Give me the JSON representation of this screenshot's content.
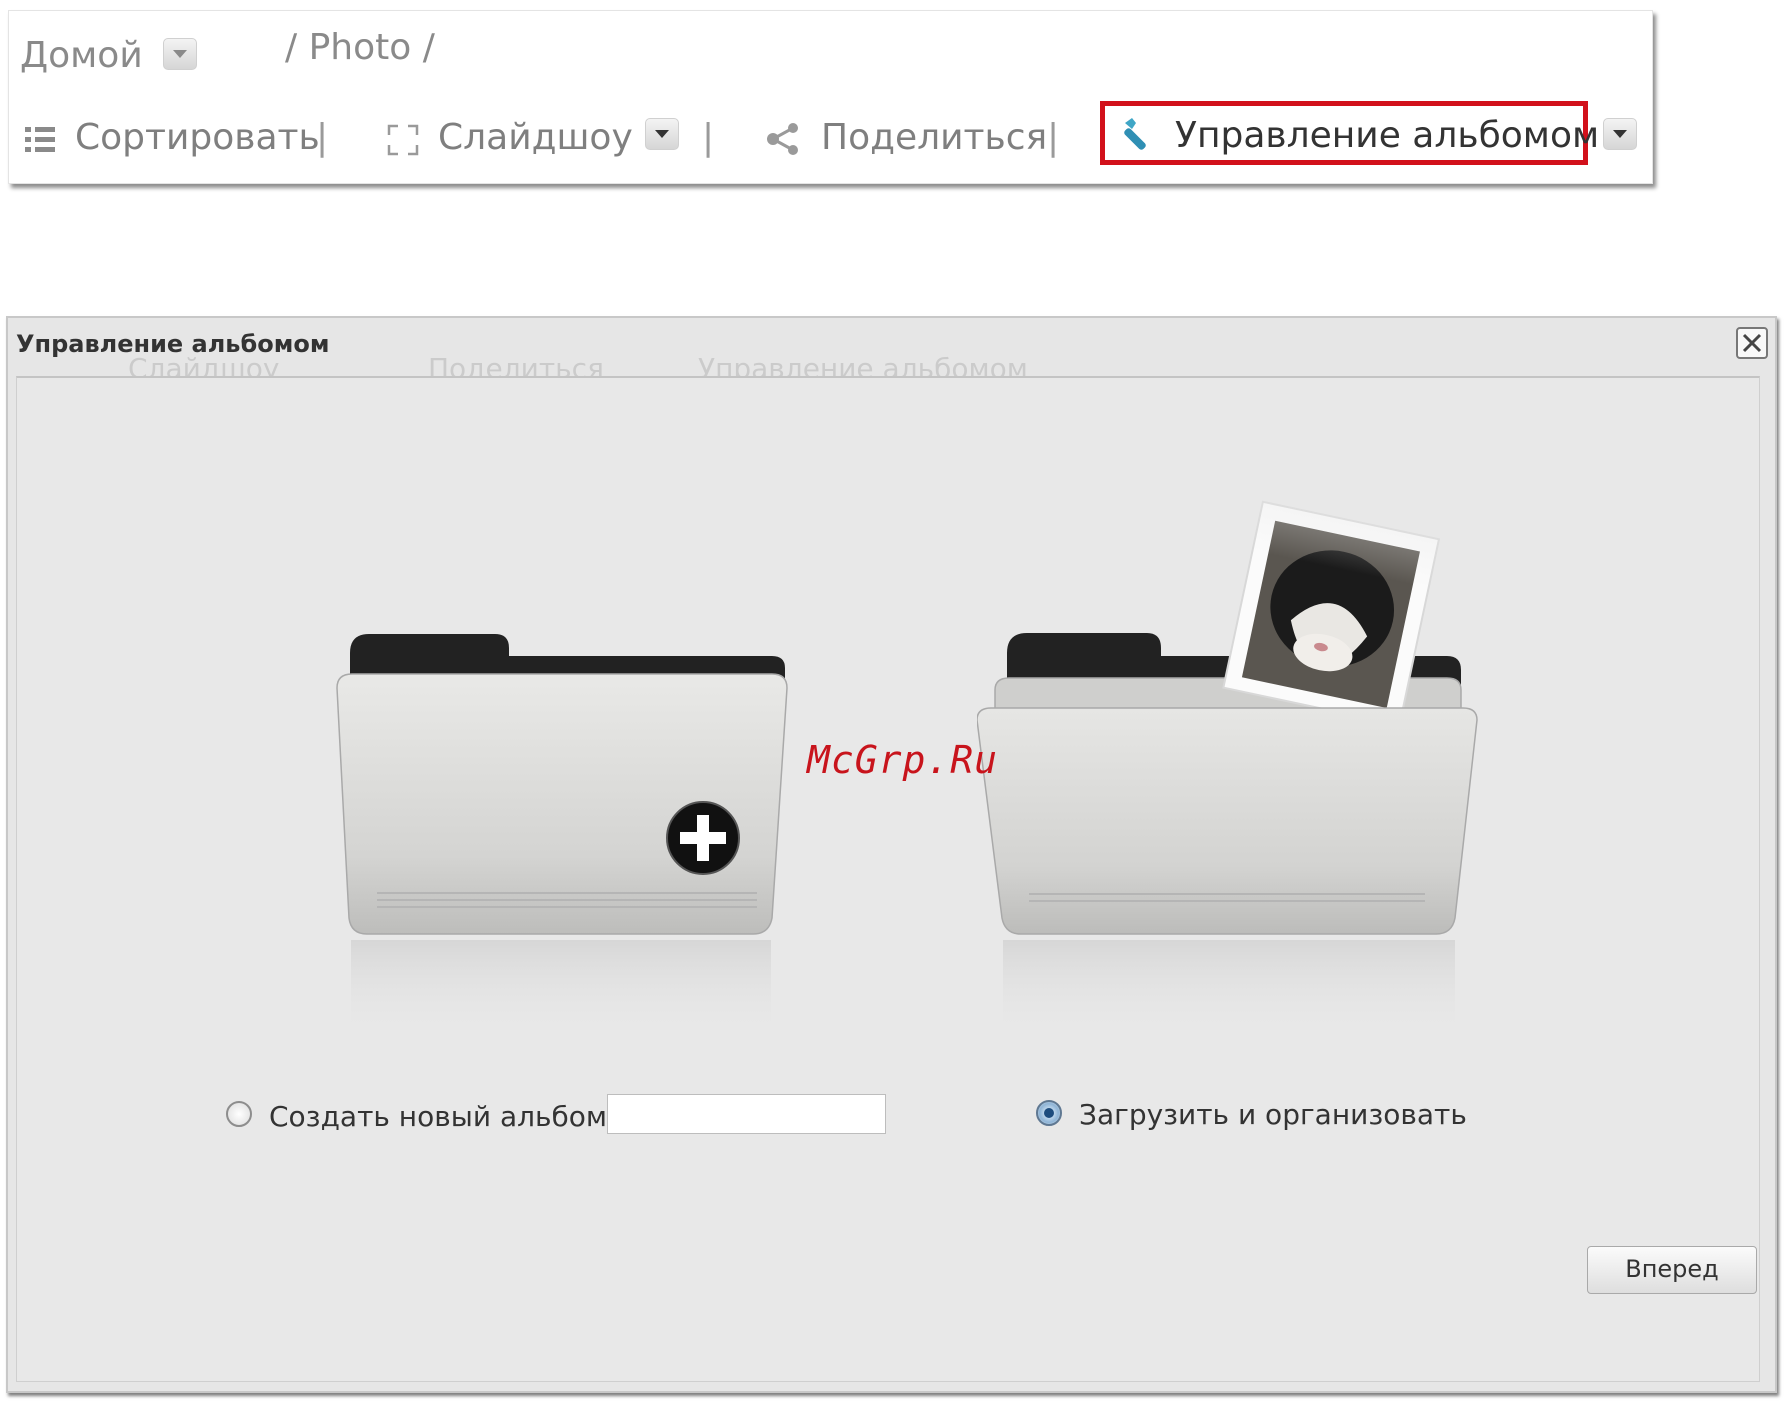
{
  "toolbar": {
    "home_label": "Домой",
    "breadcrumb": "/ Photo /",
    "sort_label": "Сортировать",
    "slideshow_label": "Слайдшоу",
    "share_label": "Поделиться",
    "manage_label": "Управление альбомом",
    "separator": "|",
    "highlight_color": "#d2111b"
  },
  "dialog": {
    "title": "Управление альбомом",
    "ghost_toolbar": {
      "slideshow": "Слайдшоу",
      "share": "Поделиться",
      "manage": "Управление альбомом"
    },
    "options": {
      "create_label": "Создать новый альбом",
      "create_selected": false,
      "create_input_value": "",
      "upload_label": "Загрузить и организовать",
      "upload_selected": true
    },
    "next_label": "Вперед"
  },
  "watermark": "McGrp.Ru",
  "icons": {
    "home_dropdown": "chevron-down-icon",
    "sort": "list-icon",
    "slideshow": "fullscreen-icon",
    "slideshow_dropdown": "chevron-down-icon",
    "share": "share-icon",
    "manage": "wrench-icon",
    "manage_dropdown": "chevron-down-icon",
    "close": "close-icon",
    "new_album_folder": "folder-add-icon",
    "upload_folder": "folder-photo-icon"
  }
}
